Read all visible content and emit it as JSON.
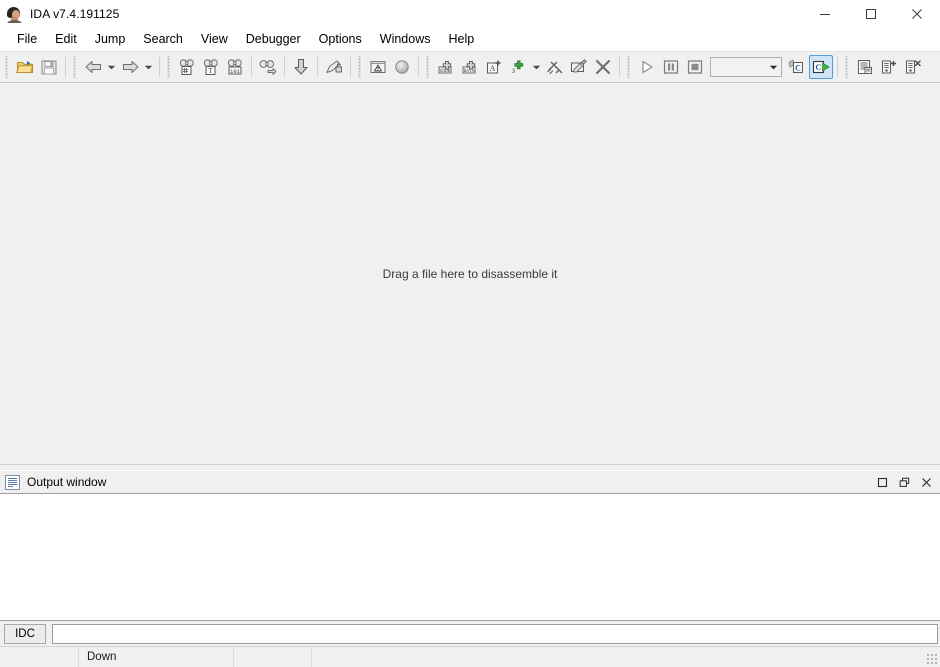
{
  "window": {
    "title": "IDA v7.4.191125",
    "app_icon": "ida-woman-icon",
    "minimize_label": "Minimize",
    "maximize_label": "Maximize",
    "close_label": "Close"
  },
  "menubar": {
    "items": [
      {
        "label": "File"
      },
      {
        "label": "Edit"
      },
      {
        "label": "Jump"
      },
      {
        "label": "Search"
      },
      {
        "label": "View"
      },
      {
        "label": "Debugger"
      },
      {
        "label": "Options"
      },
      {
        "label": "Windows"
      },
      {
        "label": "Help"
      }
    ]
  },
  "toolbar": {
    "combo_value": "",
    "items": [
      {
        "icon": "open-folder-icon",
        "name": "open-file-button"
      },
      {
        "icon": "save-disk-icon",
        "name": "save-file-button"
      },
      {
        "icon": "back-arrow-icon",
        "name": "navigate-back-button"
      },
      {
        "icon": "dropdown-caret-icon",
        "name": "navigate-back-history-button"
      },
      {
        "icon": "forward-arrow-icon",
        "name": "navigate-forward-button"
      },
      {
        "icon": "dropdown-caret-icon",
        "name": "navigate-forward-history-button"
      },
      {
        "icon": "binoculars-hex-icon",
        "name": "search-hex-button"
      },
      {
        "icon": "binoculars-text-icon",
        "name": "search-text-button"
      },
      {
        "icon": "binoculars-seq-icon",
        "name": "search-sequence-button"
      },
      {
        "icon": "binoculars-next-icon",
        "name": "search-next-button"
      },
      {
        "icon": "down-arrow-icon",
        "name": "jump-down-button"
      },
      {
        "icon": "pencil-lock-icon",
        "name": "edit-lock-button"
      },
      {
        "icon": "warning-box-icon",
        "name": "problems-button"
      },
      {
        "icon": "gray-circle-icon",
        "name": "graph-node-button"
      },
      {
        "icon": "code-plus-icon",
        "name": "make-code-button"
      },
      {
        "icon": "data-plus-icon",
        "name": "make-data-button"
      },
      {
        "icon": "ascii-plus-icon",
        "name": "make-string-button"
      },
      {
        "icon": "struct-plus-icon",
        "name": "add-struct-button"
      },
      {
        "icon": "dropdown-caret-icon",
        "name": "add-struct-menu-button"
      },
      {
        "icon": "function-icon",
        "name": "create-function-button"
      },
      {
        "icon": "rename-icon",
        "name": "rename-button"
      },
      {
        "icon": "delete-x-icon",
        "name": "undefine-button"
      },
      {
        "icon": "play-icon",
        "name": "debugger-run-button"
      },
      {
        "icon": "pause-icon",
        "name": "debugger-pause-button"
      },
      {
        "icon": "stop-icon",
        "name": "debugger-stop-button"
      },
      {
        "icon": "combobox",
        "name": "debugger-selector-combobox"
      },
      {
        "icon": "script-c-gray-icon",
        "name": "compile-script-button"
      },
      {
        "icon": "script-c-run-icon",
        "name": "execute-script-button",
        "active": true
      },
      {
        "icon": "list-notes-icon",
        "name": "notepad-button"
      },
      {
        "icon": "add-breakpoint-icon",
        "name": "add-breakpoint-button"
      },
      {
        "icon": "delete-breakpoint-icon",
        "name": "delete-breakpoint-button"
      }
    ]
  },
  "workspace": {
    "drop_hint": "Drag a file here to disassemble it"
  },
  "output_window": {
    "title": "Output window",
    "icon": "document-lines-icon",
    "content": "",
    "restore_label": "Restore",
    "float_label": "Float",
    "close_label": "Close",
    "command_tab": "IDC",
    "command_value": "",
    "command_placeholder": ""
  },
  "statusbar": {
    "cells": [
      "",
      "Down",
      "",
      ""
    ]
  },
  "colors": {
    "window_bg": "#ffffff",
    "chrome_bg": "#f0f0f0",
    "workspace_bg": "#f0f0f0",
    "output_bg": "#ffffff",
    "accent_active": "#5b9bd5",
    "accent_green": "#2e9e43",
    "folder_yellow": "#f5c349"
  }
}
